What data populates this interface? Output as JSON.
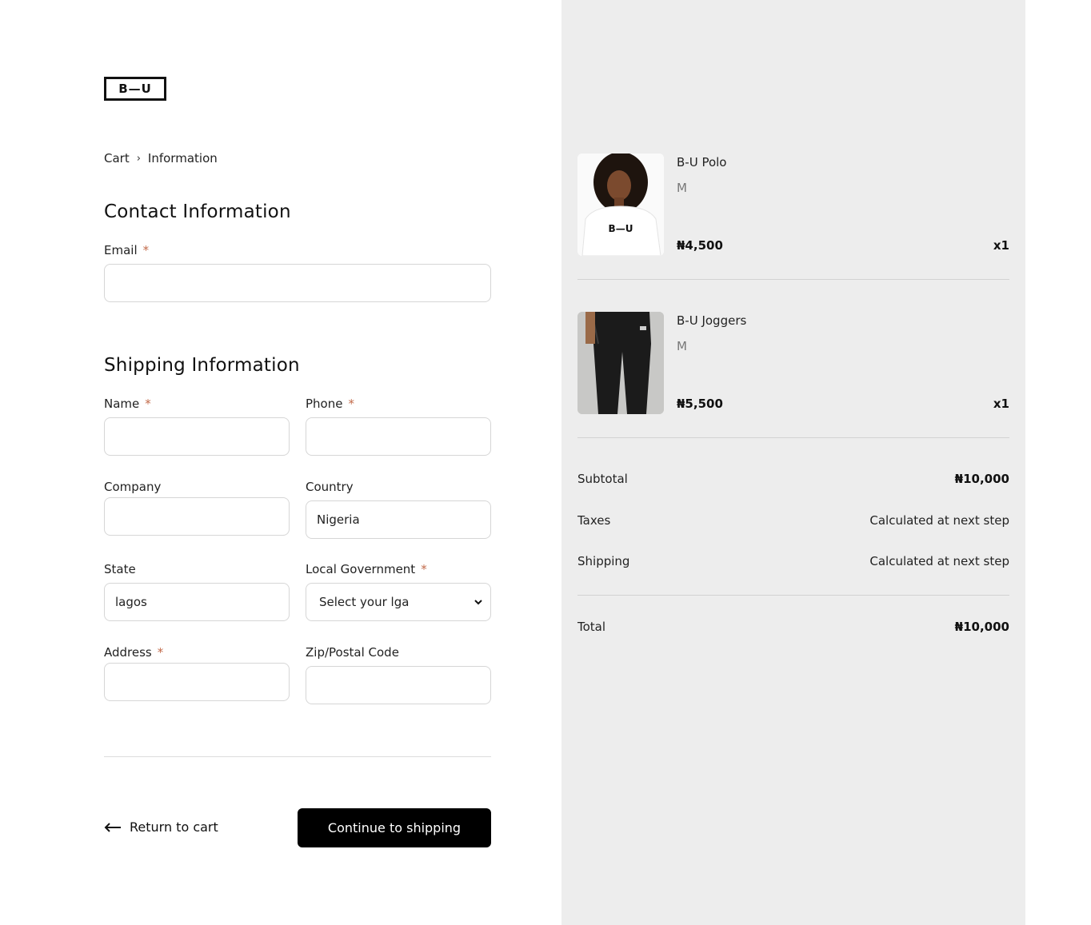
{
  "brand": {
    "logo_text": "B—U"
  },
  "breadcrumb": {
    "items": [
      "Cart",
      "Information"
    ],
    "separator": "›"
  },
  "contact": {
    "heading": "Contact Information",
    "email_label": "Email",
    "required_mark": "*",
    "email_value": ""
  },
  "shipping": {
    "heading": "Shipping Information",
    "name_label": "Name",
    "phone_label": "Phone",
    "company_label": "Company",
    "country_label": "Country",
    "country_value": "Nigeria",
    "state_label": "State",
    "state_value": "lagos",
    "lga_label": "Local Government",
    "lga_selected": "Select your lga",
    "address_label": "Address",
    "zip_label": "Zip/Postal Code"
  },
  "actions": {
    "return_label": "Return to cart",
    "continue_label": "Continue to shipping"
  },
  "cart": {
    "items": [
      {
        "name": "B-U Polo",
        "variant": "M",
        "price": "₦4,500",
        "qty": "x1",
        "image": "woman-white-polo"
      },
      {
        "name": "B-U Joggers",
        "variant": "M",
        "price": "₦5,500",
        "qty": "x1",
        "image": "black-joggers"
      }
    ]
  },
  "summary": {
    "subtotal_label": "Subtotal",
    "subtotal_value": "₦10,000",
    "taxes_label": "Taxes",
    "taxes_value": "Calculated at next step",
    "shipping_label": "Shipping",
    "shipping_value": "Calculated at next step",
    "total_label": "Total",
    "total_value": "₦10,000"
  },
  "colors": {
    "sidebar_bg": "#ededed",
    "required": "#c26a4a",
    "cta_bg": "#000000"
  }
}
